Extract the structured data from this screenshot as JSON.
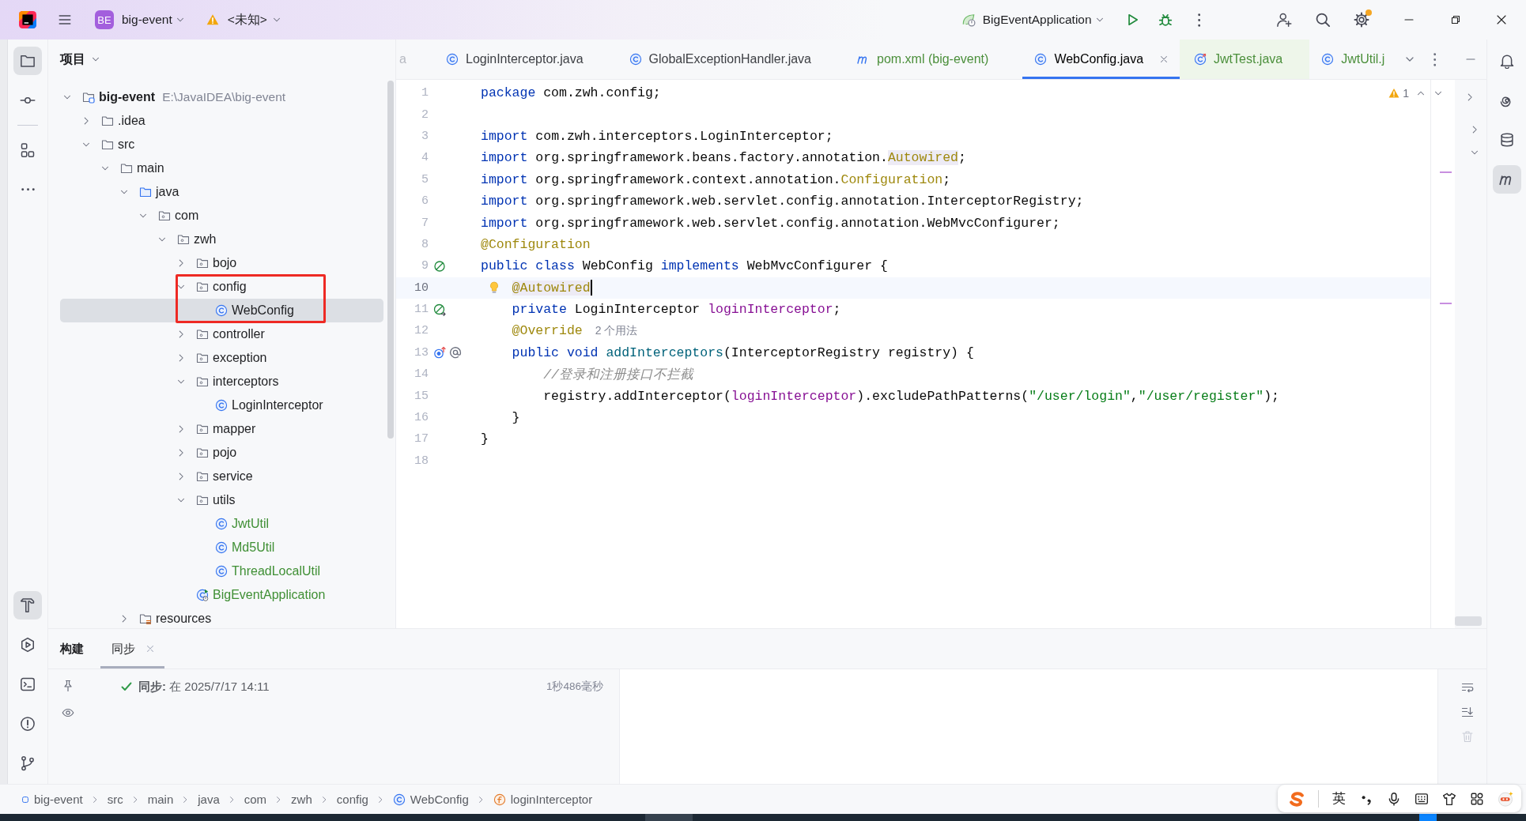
{
  "title_bar": {
    "project_badge": "BE",
    "project": "big-event",
    "vcs_branch": "<未知>",
    "run_configuration": "BigEventApplication",
    "update_available": true
  },
  "left_toolbar": {
    "top": [
      {
        "kind": "project",
        "selected": true
      },
      {
        "kind": "commit",
        "selected": false
      },
      {
        "kind": "structure",
        "selected": false
      },
      {
        "kind": "more",
        "selected": false
      }
    ],
    "bottom": [
      {
        "kind": "build",
        "selected": true
      },
      {
        "kind": "services",
        "selected": false
      },
      {
        "kind": "terminal",
        "selected": false
      },
      {
        "kind": "problems",
        "selected": false
      },
      {
        "kind": "git",
        "selected": false
      }
    ]
  },
  "project_panel": {
    "title": "项目",
    "tree": [
      {
        "name": "big-event",
        "kind": "module",
        "path": "E:\\JavaIDEA\\big-event",
        "expanded": true,
        "selected": false,
        "added": false,
        "children": [
          {
            "name": ".idea",
            "kind": "folder",
            "expanded": false,
            "selected": false,
            "added": false
          },
          {
            "name": "src",
            "kind": "folder",
            "expanded": true,
            "selected": false,
            "added": false,
            "children": [
              {
                "name": "main",
                "kind": "folder",
                "expanded": true,
                "selected": false,
                "added": false,
                "children": [
                  {
                    "name": "java",
                    "kind": "source-folder",
                    "expanded": true,
                    "selected": false,
                    "added": false,
                    "children": [
                      {
                        "name": "com",
                        "kind": "package",
                        "expanded": true,
                        "selected": false,
                        "added": false,
                        "children": [
                          {
                            "name": "zwh",
                            "kind": "package",
                            "expanded": true,
                            "selected": false,
                            "added": false,
                            "children": [
                              {
                                "name": "bojo",
                                "kind": "package",
                                "expanded": false,
                                "selected": false,
                                "added": false
                              },
                              {
                                "name": "config",
                                "kind": "package",
                                "expanded": true,
                                "selected": false,
                                "added": false,
                                "framed": true,
                                "children": [
                                  {
                                    "name": "WebConfig",
                                    "kind": "class",
                                    "selected": true,
                                    "added": false
                                  }
                                ]
                              },
                              {
                                "name": "controller",
                                "kind": "package",
                                "expanded": false,
                                "selected": false,
                                "added": false
                              },
                              {
                                "name": "exception",
                                "kind": "package",
                                "expanded": false,
                                "selected": false,
                                "added": false
                              },
                              {
                                "name": "interceptors",
                                "kind": "package",
                                "expanded": true,
                                "selected": false,
                                "added": false,
                                "children": [
                                  {
                                    "name": "LoginInterceptor",
                                    "kind": "class",
                                    "selected": false,
                                    "added": false
                                  }
                                ]
                              },
                              {
                                "name": "mapper",
                                "kind": "package",
                                "expanded": false,
                                "selected": false,
                                "added": false
                              },
                              {
                                "name": "pojo",
                                "kind": "package",
                                "expanded": false,
                                "selected": false,
                                "added": false
                              },
                              {
                                "name": "service",
                                "kind": "package",
                                "expanded": false,
                                "selected": false,
                                "added": false
                              },
                              {
                                "name": "utils",
                                "kind": "package",
                                "expanded": true,
                                "selected": false,
                                "added": false,
                                "children": [
                                  {
                                    "name": "JwtUtil",
                                    "kind": "class",
                                    "selected": false,
                                    "added": true
                                  },
                                  {
                                    "name": "Md5Util",
                                    "kind": "class",
                                    "selected": false,
                                    "added": true
                                  },
                                  {
                                    "name": "ThreadLocalUtil",
                                    "kind": "class",
                                    "selected": false,
                                    "added": true
                                  }
                                ]
                              },
                              {
                                "name": "BigEventApplication",
                                "kind": "app-class",
                                "selected": false,
                                "added": true
                              }
                            ]
                          }
                        ]
                      }
                    ]
                  },
                  {
                    "name": "resources",
                    "kind": "resources-folder",
                    "expanded": false,
                    "selected": false,
                    "added": false
                  }
                ]
              }
            ]
          }
        ]
      }
    ]
  },
  "editor": {
    "tabs": [
      {
        "label": "a",
        "kind": "fragment",
        "selected": false,
        "added": false
      },
      {
        "label": "LoginInterceptor.java",
        "kind": "class",
        "selected": false,
        "added": false
      },
      {
        "label": "GlobalExceptionHandler.java",
        "kind": "class",
        "selected": false,
        "added": false
      },
      {
        "label": "pom.xml (big-event)",
        "kind": "maven",
        "selected": false,
        "added": true
      },
      {
        "label": "WebConfig.java",
        "kind": "class",
        "selected": true,
        "added": false
      },
      {
        "label": "JwtTest.java",
        "kind": "test",
        "selected": false,
        "added": true
      },
      {
        "label": "JwtUtil.j",
        "kind": "class",
        "selected": false,
        "added": true
      }
    ],
    "warnings": "1",
    "lines": [
      {
        "number": "1",
        "current": false,
        "tokens": [
          {
            "text": "package",
            "kind": "keyword"
          },
          {
            "text": " com.zwh.config;",
            "kind": "plain"
          }
        ]
      },
      {
        "number": "2",
        "current": false
      },
      {
        "number": "3",
        "current": false,
        "tokens": [
          {
            "text": "import",
            "kind": "keyword"
          },
          {
            "text": " com.zwh.interceptors.LoginInterceptor;",
            "kind": "plain"
          }
        ]
      },
      {
        "number": "4",
        "current": false,
        "tokens": [
          {
            "text": "import",
            "kind": "keyword"
          },
          {
            "text": " org.springframework.beans.factory.annotation.",
            "kind": "plain"
          },
          {
            "text": "Autowired",
            "kind": "annotation",
            "highlight": true
          },
          {
            "text": ";",
            "kind": "plain"
          }
        ]
      },
      {
        "number": "5",
        "current": false,
        "tokens": [
          {
            "text": "import",
            "kind": "keyword"
          },
          {
            "text": " org.springframework.context.annotation.",
            "kind": "plain"
          },
          {
            "text": "Configuration",
            "kind": "annotation"
          },
          {
            "text": ";",
            "kind": "plain"
          }
        ]
      },
      {
        "number": "6",
        "current": false,
        "tokens": [
          {
            "text": "import",
            "kind": "keyword"
          },
          {
            "text": " org.springframework.web.servlet.config.annotation.InterceptorRegistry;",
            "kind": "plain"
          }
        ]
      },
      {
        "number": "7",
        "current": false,
        "tokens": [
          {
            "text": "import",
            "kind": "keyword"
          },
          {
            "text": " org.springframework.web.servlet.config.annotation.WebMvcConfigurer;",
            "kind": "plain"
          }
        ]
      },
      {
        "number": "8",
        "current": false,
        "tokens": [
          {
            "text": "@Configuration",
            "kind": "annotation"
          }
        ]
      },
      {
        "number": "9",
        "current": false,
        "gutter_icons": [
          {
            "kind": "bean"
          }
        ],
        "tokens": [
          {
            "text": "public class",
            "kind": "keyword"
          },
          {
            "text": " WebConfig ",
            "kind": "plain"
          },
          {
            "text": "implements",
            "kind": "keyword"
          },
          {
            "text": " WebMvcConfigurer {",
            "kind": "plain"
          }
        ]
      },
      {
        "number": "10",
        "current": true,
        "caret": true,
        "intention_bulb": true,
        "tokens": [
          {
            "text": "    @Autowired",
            "kind": "annotation",
            "highlight": true
          }
        ]
      },
      {
        "number": "11",
        "current": false,
        "gutter_icons": [
          {
            "kind": "autowired"
          }
        ],
        "tokens": [
          {
            "text": "    private",
            "kind": "keyword"
          },
          {
            "text": " LoginInterceptor ",
            "kind": "plain"
          },
          {
            "text": "loginInterceptor",
            "kind": "field"
          },
          {
            "text": ";",
            "kind": "plain"
          }
        ]
      },
      {
        "number": "12",
        "current": false,
        "tokens": [
          {
            "text": "    @Override",
            "kind": "annotation"
          },
          {
            "text": "2 个用法",
            "kind": "hint"
          }
        ]
      },
      {
        "number": "13",
        "current": false,
        "gutter_icons": [
          {
            "kind": "override"
          },
          {
            "kind": "at"
          }
        ],
        "tokens": [
          {
            "text": "    public void",
            "kind": "keyword"
          },
          {
            "text": " addInterceptors",
            "kind": "method"
          },
          {
            "text": "(InterceptorRegistry registry) {",
            "kind": "plain"
          }
        ]
      },
      {
        "number": "14",
        "current": false,
        "tokens": [
          {
            "text": "        //登录和注册接口不拦截",
            "kind": "comment"
          }
        ]
      },
      {
        "number": "15",
        "current": false,
        "tokens": [
          {
            "text": "        registry.addInterceptor(",
            "kind": "plain"
          },
          {
            "text": "loginInterceptor",
            "kind": "field"
          },
          {
            "text": ").excludePathPatterns(",
            "kind": "plain"
          },
          {
            "text": "\"/user/login\"",
            "kind": "string"
          },
          {
            "text": ",",
            "kind": "plain"
          },
          {
            "text": "\"/user/register\"",
            "kind": "string"
          },
          {
            "text": ");",
            "kind": "plain"
          }
        ]
      },
      {
        "number": "16",
        "current": false,
        "tokens": [
          {
            "text": "    }",
            "kind": "plain"
          }
        ]
      },
      {
        "number": "17",
        "current": false,
        "tokens": [
          {
            "text": "}",
            "kind": "plain"
          }
        ]
      },
      {
        "number": "18",
        "current": false
      }
    ]
  },
  "right_toolbar": [
    {
      "kind": "notifications",
      "selected": false
    },
    {
      "kind": "ai-assistant",
      "selected": false
    },
    {
      "kind": "database",
      "selected": false
    },
    {
      "kind": "maven",
      "selected": true
    }
  ],
  "bottom_panel": {
    "title": "构建",
    "tabs": [
      {
        "label": "同步",
        "selected": true,
        "closable": true
      }
    ],
    "events": [
      {
        "kind": "success",
        "text": "**同步:** 在 2025/7/17 14:11",
        "duration": "1秒486毫秒"
      }
    ],
    "console_toolbar": [
      {
        "kind": "soft-wrap",
        "disabled": false
      },
      {
        "kind": "scroll-to-end",
        "disabled": false
      },
      {
        "kind": "clear",
        "disabled": true
      }
    ]
  },
  "status_bar": {
    "breadcrumbs": [
      {
        "label": "big-event",
        "kind": "module"
      },
      {
        "label": "src",
        "kind": "folder"
      },
      {
        "label": "main",
        "kind": "folder"
      },
      {
        "label": "java",
        "kind": "folder"
      },
      {
        "label": "com",
        "kind": "folder"
      },
      {
        "label": "zwh",
        "kind": "folder"
      },
      {
        "label": "config",
        "kind": "folder"
      },
      {
        "label": "WebConfig",
        "kind": "class"
      },
      {
        "label": "loginInterceptor",
        "kind": "field"
      }
    ]
  },
  "ime_toolbar": {
    "mode": "英"
  }
}
